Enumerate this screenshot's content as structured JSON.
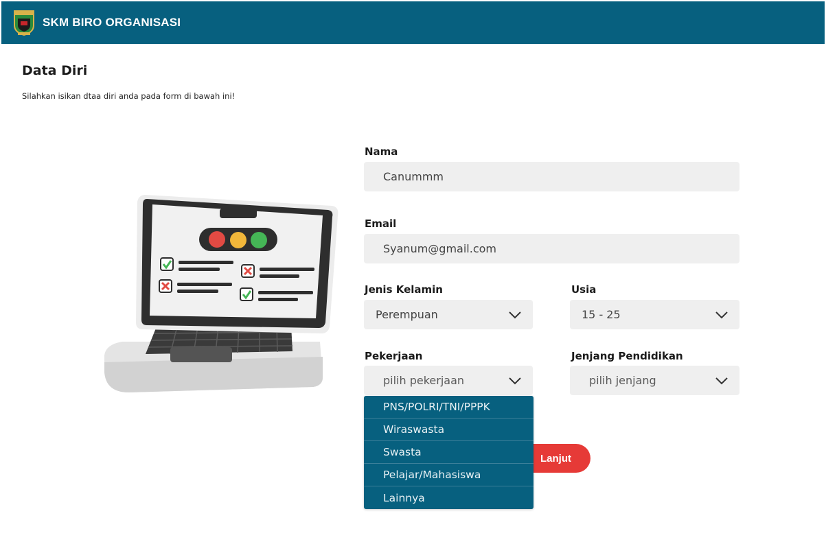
{
  "header": {
    "title": "SKM BIRO ORGANISASI",
    "logo_icon": "province-emblem-icon"
  },
  "page": {
    "title": "Data Diri",
    "subtitle": "Silahkan isikan dtaa diri anda pada form di bawah ini!"
  },
  "form": {
    "nama": {
      "label": "Nama",
      "value": "Canummm"
    },
    "email": {
      "label": "Email",
      "value": "Syanum@gmail.com"
    },
    "jenis_kelamin": {
      "label": "Jenis Kelamin",
      "value": "Perempuan"
    },
    "usia": {
      "label": "Usia",
      "value": "15 - 25"
    },
    "pekerjaan": {
      "label": "Pekerjaan",
      "placeholder": "pilih pekerjaan",
      "options": [
        "PNS/POLRI/TNI/PPPK",
        "Wiraswasta",
        "Swasta",
        "Pelajar/Mahasiswa",
        "Lainnya"
      ]
    },
    "jenjang": {
      "label": "Jenjang Pendidikan",
      "placeholder": "pilih jenjang"
    },
    "next_label": "Lanjut"
  },
  "colors": {
    "header": "#07607f",
    "button": "#e63a37",
    "field": "#efefef",
    "dropdown": "#07607f"
  }
}
